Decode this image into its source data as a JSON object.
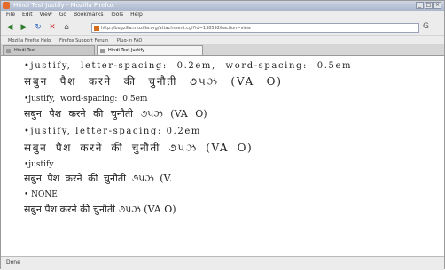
{
  "window": {
    "title": "Hindi Test Justify - Mozilla Firefox"
  },
  "menu": [
    "File",
    "Edit",
    "View",
    "Go",
    "Bookmarks",
    "Tools",
    "Help"
  ],
  "nav": {
    "url": "http://bugzilla.mozilla.org/attachment.cgi?id=138592&action=view"
  },
  "bookmarks": [
    "Mozilla Firefox Help",
    "Firefox Support Forum",
    "Plug-in FAQ"
  ],
  "tabs": [
    {
      "label": "Hindi Test",
      "active": false
    },
    {
      "label": "Hindi Test Justify",
      "active": true
    }
  ],
  "content": {
    "b1_label": "•justify, letter-spacing: 0.2em, word-spacing: 0.5em",
    "b1_text": "सबुन पैश करने की चुनौती ૭૫ઝ (VA O)",
    "b2_label": "•justify, word-spacing: 0.5em",
    "b2_text": "सबुन पैश करने की चुनौती ૭૫ઝ (VA O)",
    "b3_label": "•justify, letter-spacing: 0.2em",
    "b3_text": "सबुन पैश करने की चुनौती ૭૫ઝ (VA O)",
    "b4_label": "•justify",
    "b4_text": "सबुन पैश करने की चुनौती ૭૫ઝ (V.",
    "b5_label": "• NONE",
    "b5_text": "सबुन पैश करने की चुनौती ૭૫ઝ (VA O)"
  },
  "status": "Done"
}
